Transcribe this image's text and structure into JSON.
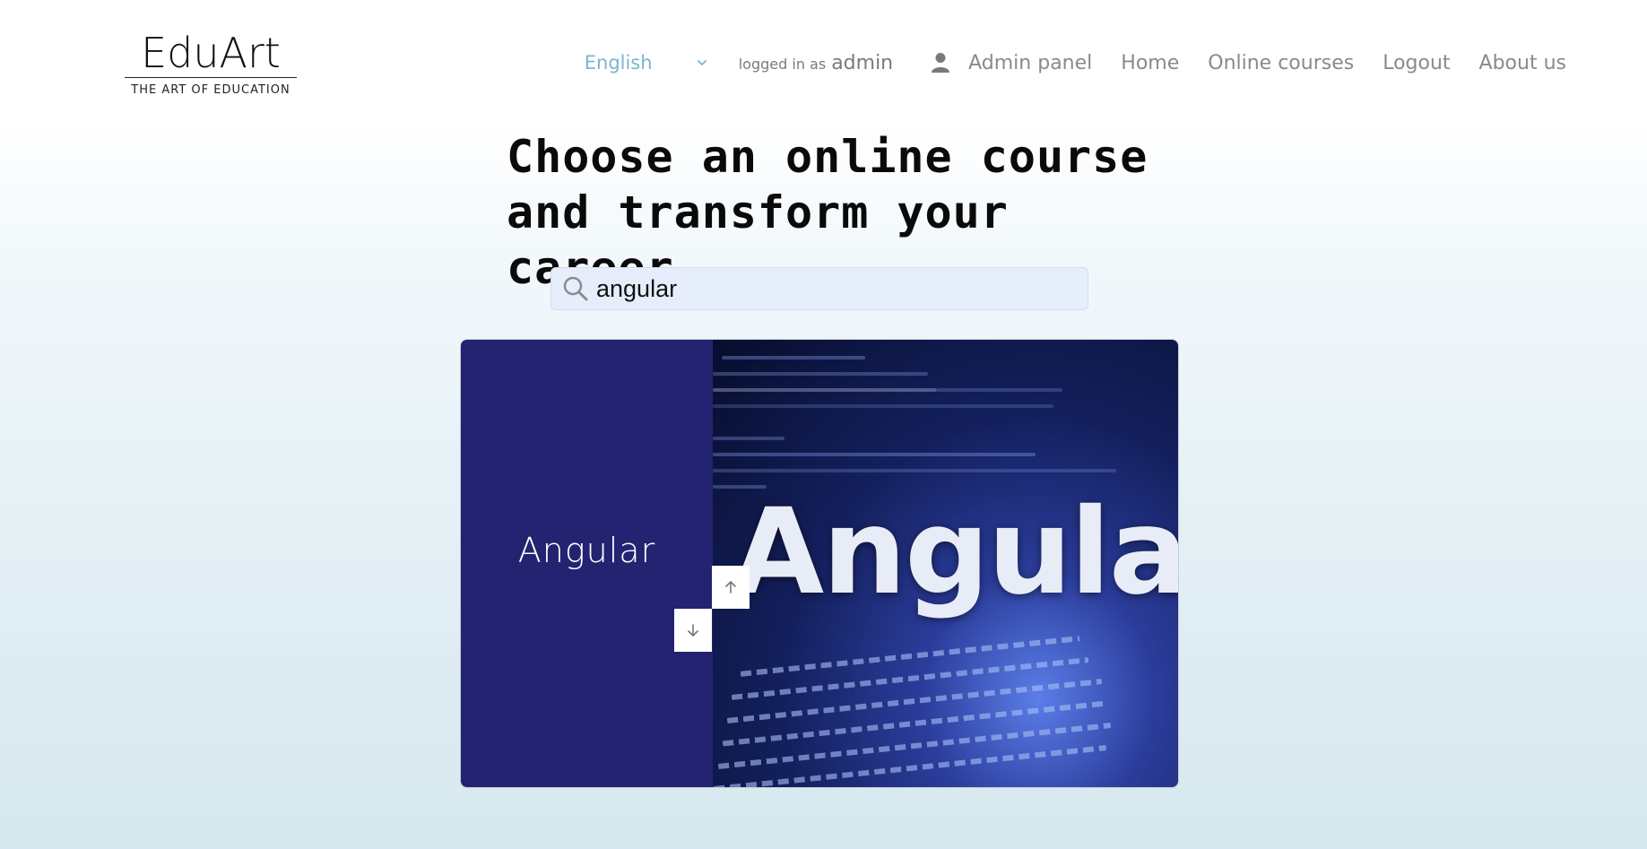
{
  "logo": {
    "name": "EduArt",
    "tagline": "THE ART OF EDUCATION"
  },
  "nav": {
    "language": "English",
    "logged_in_prefix": "logged in as",
    "username": "admin",
    "links": [
      "Admin panel",
      "Home",
      "Online courses",
      "Logout",
      "About us"
    ]
  },
  "hero": {
    "line1": "Choose an online course",
    "line2": "and transform your career"
  },
  "search": {
    "value": "angular"
  },
  "course": {
    "title": "Angular",
    "image_text": "Angular"
  },
  "colors": {
    "card_panel": "#232372",
    "language": "#7bb4d3",
    "nav_link": "#8a8a8a"
  },
  "icons": {
    "search": "search-icon",
    "user": "user-icon",
    "chevron": "chevron-down-icon",
    "up": "arrow-up-icon",
    "down": "arrow-down-icon"
  }
}
